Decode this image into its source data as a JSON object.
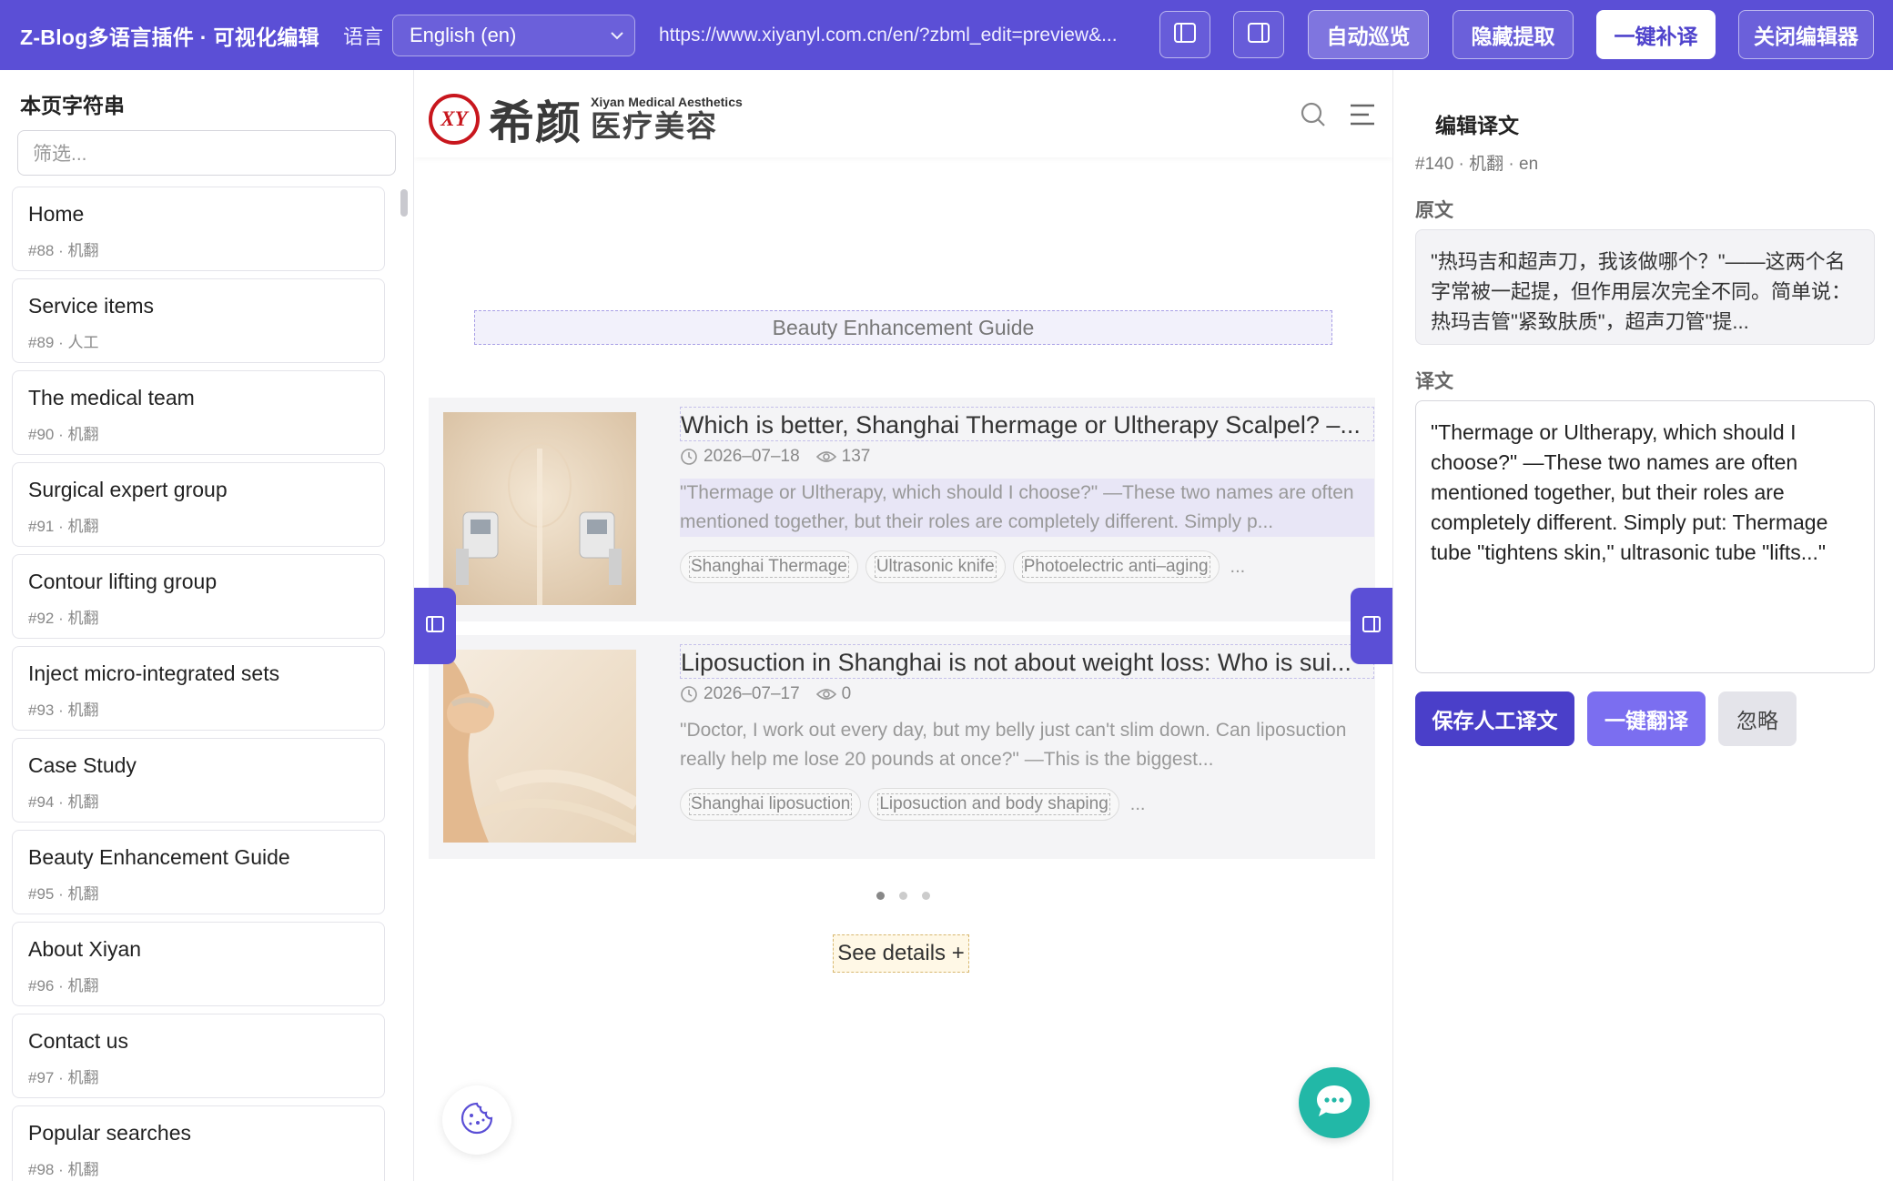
{
  "toolbar": {
    "brand": "Z-Blog多语言插件 · 可视化编辑",
    "language_label": "语言",
    "language_value": "English (en)",
    "url": "https://www.xiyanyl.com.cn/en/?zbml_edit=preview&...",
    "auto_tour": "自动巡览",
    "hide_extract": "隐藏提取",
    "fill_translate": "一键补译",
    "close_editor": "关闭编辑器"
  },
  "sidebar": {
    "title": "本页字符串",
    "filter_placeholder": "筛选...",
    "items": [
      {
        "text": "Home",
        "meta": "#88 · 机翻"
      },
      {
        "text": "Service items",
        "meta": "#89 · 人工"
      },
      {
        "text": "The medical team",
        "meta": "#90 · 机翻"
      },
      {
        "text": "Surgical expert group",
        "meta": "#91 · 机翻"
      },
      {
        "text": "Contour lifting group",
        "meta": "#92 · 机翻"
      },
      {
        "text": "Inject micro-integrated sets",
        "meta": "#93 · 机翻"
      },
      {
        "text": "Case Study",
        "meta": "#94 · 机翻"
      },
      {
        "text": "Beauty Enhancement Guide",
        "meta": "#95 · 机翻"
      },
      {
        "text": "About Xiyan",
        "meta": "#96 · 机翻"
      },
      {
        "text": "Contact us",
        "meta": "#97 · 机翻"
      },
      {
        "text": "Popular searches",
        "meta": "#98 · 机翻"
      }
    ]
  },
  "site": {
    "logo_mark": "XY",
    "logo_cn": "希颜",
    "logo_en": "Xiyan Medical Aesthetics",
    "logo_sub_cn": "医疗美容",
    "section_title": "Beauty Enhancement Guide",
    "articles": [
      {
        "title": "Which is better, Shanghai Thermage or Ultherapy Scalpel? –...",
        "date": "2026–07–18",
        "views": "137",
        "excerpt": "\"Thermage or Ultherapy, which should I choose?\" —These two names are often mentioned together, but their roles are completely different. Simply p...",
        "tags": [
          "Shanghai Thermage",
          "Ultrasonic knife",
          "Photoelectric anti–aging"
        ],
        "more": "..."
      },
      {
        "title": "Liposuction in Shanghai is not about weight loss: Who is sui...",
        "date": "2026–07–17",
        "views": "0",
        "excerpt": "\"Doctor, I work out every day, but my belly just can't slim down. Can liposuction really help me lose 20 pounds at once?\" —This is the biggest...",
        "tags": [
          "Shanghai liposuction",
          "Liposuction and body shaping"
        ],
        "more": "..."
      }
    ],
    "see_details": "See details +"
  },
  "editor": {
    "title": "编辑译文",
    "meta": "#140 · 机翻 · en",
    "source_label": "原文",
    "source_text": "\"热玛吉和超声刀，我该做哪个？\"——这两个名字常被一起提，但作用层次完全不同。简单说：热玛吉管\"紧致肤质\"，超声刀管\"提...",
    "translation_label": "译文",
    "translation_text": "\"Thermage or Ultherapy, which should I choose?\" —These two names are often mentioned together, but their roles are completely different. Simply put: Thermage tube \"tightens skin,\" ultrasonic tube \"lifts...\"",
    "save_label": "保存人工译文",
    "translate_label": "一键翻译",
    "ignore_label": "忽略"
  },
  "colors": {
    "accent": "#5b4fd6",
    "logo_red": "#c8161d",
    "chat": "#22b8a7"
  }
}
